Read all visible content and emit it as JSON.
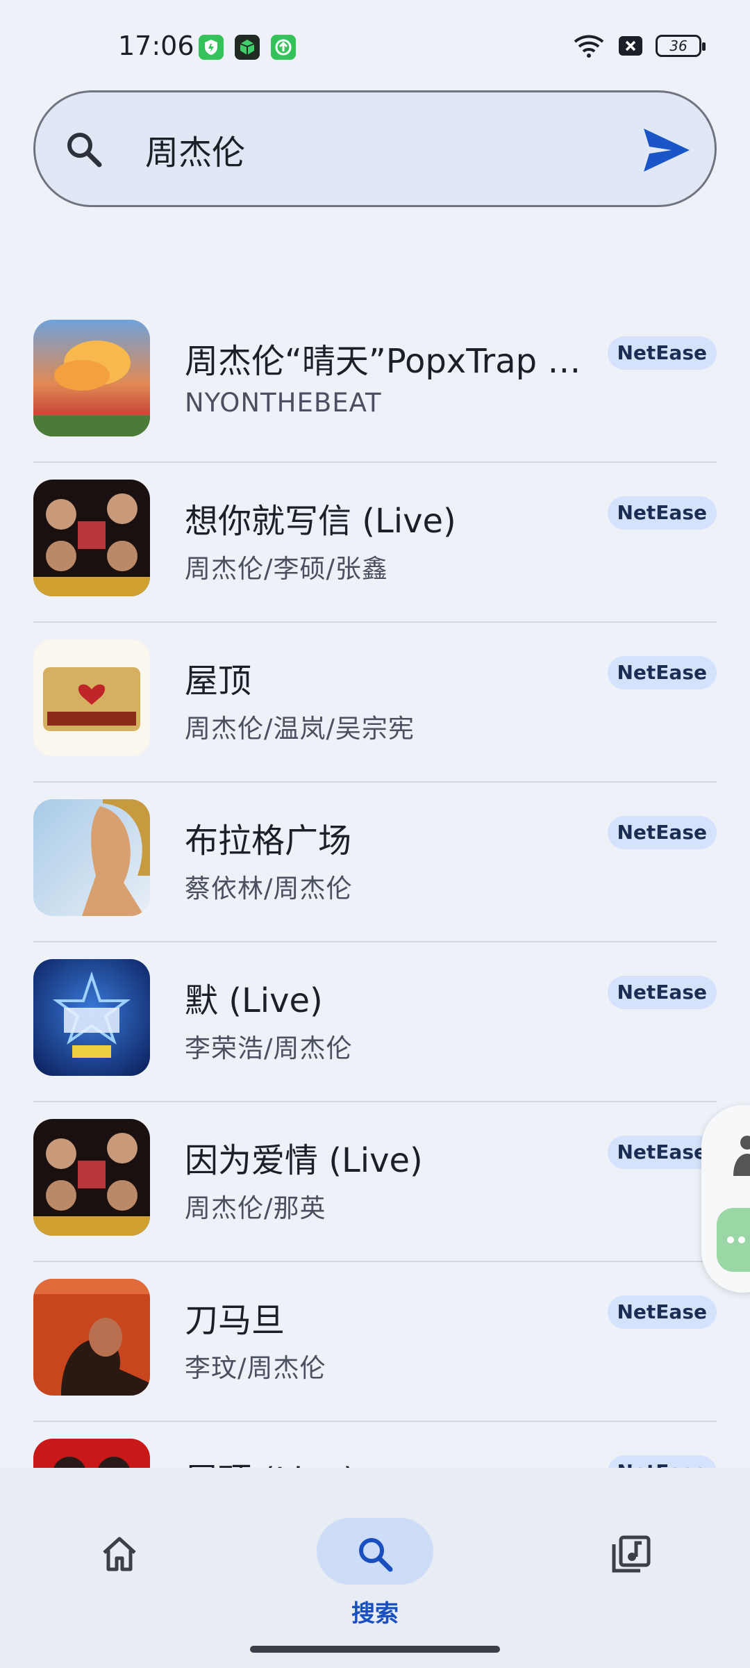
{
  "status_bar": {
    "time": "17:06",
    "battery": "36",
    "icons": [
      "shield-app-icon",
      "cube-app-icon",
      "upload-app-icon",
      "wifi-icon",
      "sim-off-icon",
      "battery-icon"
    ]
  },
  "search": {
    "query": "周杰伦",
    "placeholder": "",
    "icon": "search-icon",
    "submit_icon": "send-icon"
  },
  "results": [
    {
      "title": "周杰伦“晴天”PopxTrap Beat",
      "artist": "NYONTHEBEAT",
      "source": "NetEase"
    },
    {
      "title": "想你就写信 (Live)",
      "artist": "周杰伦/李硕/张鑫",
      "source": "NetEase"
    },
    {
      "title": "屋顶",
      "artist": "周杰伦/温岚/吴宗宪",
      "source": "NetEase"
    },
    {
      "title": "布拉格广场",
      "artist": "蔡依林/周杰伦",
      "source": "NetEase"
    },
    {
      "title": "默 (Live)",
      "artist": "李荣浩/周杰伦",
      "source": "NetEase"
    },
    {
      "title": "因为爱情 (Live)",
      "artist": "周杰伦/那英",
      "source": "NetEase"
    },
    {
      "title": "刀马旦",
      "artist": "李玟/周杰伦",
      "source": "NetEase"
    },
    {
      "title": "屋顶 (Live)",
      "artist": "",
      "source": "NetEase"
    }
  ],
  "bottom_nav": {
    "home_icon": "home-icon",
    "search_label": "搜索",
    "search_icon": "search-icon",
    "library_icon": "music-library-icon"
  },
  "colors": {
    "background": "#eef2f8",
    "accent": "#1a4fbf",
    "badge_bg": "#d5e2fb"
  }
}
